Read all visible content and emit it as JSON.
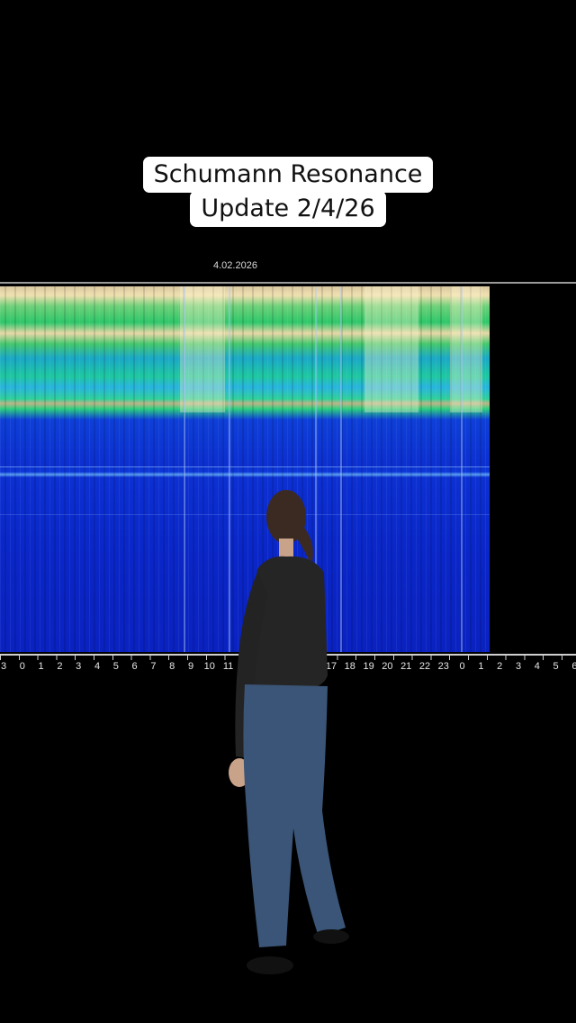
{
  "caption": {
    "line1": "Schumann Resonance",
    "line2": "Update 2/4/26"
  },
  "spectrogram": {
    "date_label": "4.02.2026",
    "hour_ticks": [
      "3",
      "0",
      "1",
      "2",
      "3",
      "4",
      "5",
      "6",
      "7",
      "8",
      "9",
      "10",
      "11",
      "17",
      "18",
      "19",
      "20",
      "21",
      "22",
      "23",
      "0",
      "1",
      "2",
      "3",
      "4",
      "5",
      "6"
    ],
    "colors": {
      "background": "#000000",
      "low": "#0a22c0",
      "mid": "#2ec76a",
      "high": "#f0e0b0"
    }
  },
  "overlay": {
    "figure": "person-standing-back-view",
    "top_color": "#2a2a2a",
    "jeans_color": "#3a5577"
  }
}
